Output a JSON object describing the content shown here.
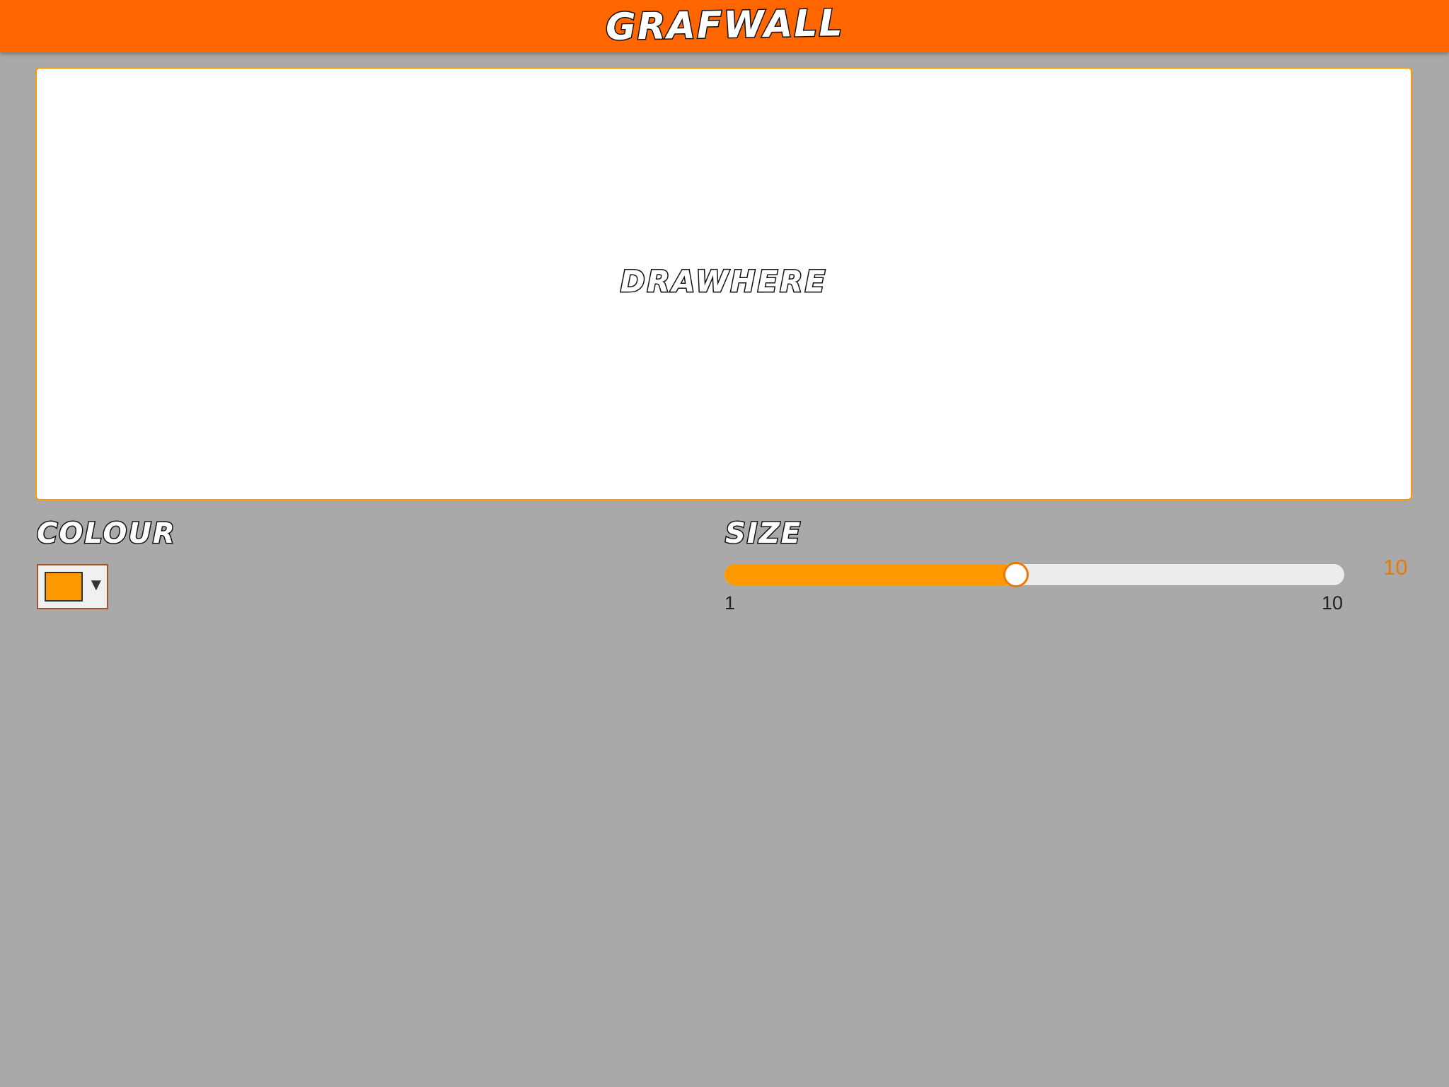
{
  "header": {
    "title": "GRAFWALL"
  },
  "canvas": {
    "hint": "DRAWHERE"
  },
  "colour": {
    "label": "COLOUR",
    "selected": "#ff9900",
    "dropdown_icon": "triangle-down-icon"
  },
  "size": {
    "label": "SIZE",
    "min": "1",
    "max": "10",
    "current_display": "10",
    "fill_fraction": 0.47
  },
  "colors": {
    "header_bg": "#ff6600",
    "accent": "#ff9900",
    "value_text": "#ee7700",
    "page_bg": "#a9a9a9"
  }
}
